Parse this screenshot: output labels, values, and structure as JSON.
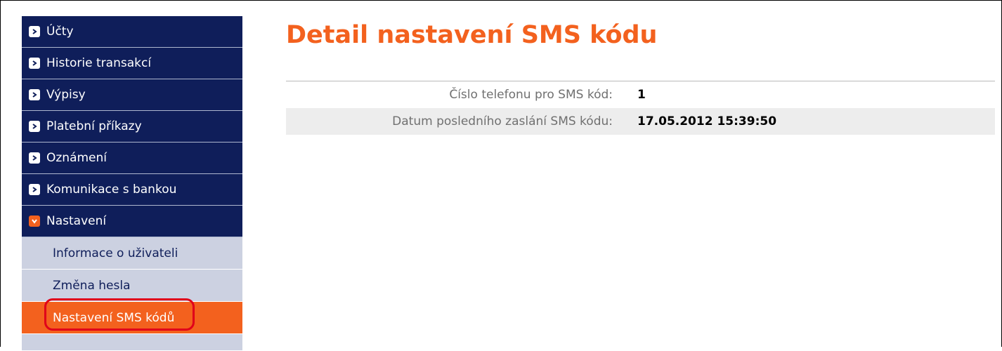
{
  "sidebar": {
    "items": [
      {
        "label": "Účty",
        "state": "collapsed"
      },
      {
        "label": "Historie transakcí",
        "state": "collapsed"
      },
      {
        "label": "Výpisy",
        "state": "collapsed"
      },
      {
        "label": "Platební příkazy",
        "state": "collapsed"
      },
      {
        "label": "Oznámení",
        "state": "collapsed"
      },
      {
        "label": "Komunikace s bankou",
        "state": "collapsed"
      },
      {
        "label": "Nastavení",
        "state": "expanded"
      }
    ],
    "sub_items": [
      {
        "label": "Informace o uživateli"
      },
      {
        "label": "Změna hesla"
      },
      {
        "label": "Nastavení SMS kódů",
        "active": true
      }
    ]
  },
  "main": {
    "title": "Detail nastavení SMS kódu",
    "rows": [
      {
        "label": "Číslo telefonu pro SMS kód:",
        "value": "1"
      },
      {
        "label": "Datum posledního zaslání SMS kódu:",
        "value": "17.05.2012 15:39:50"
      }
    ]
  },
  "colors": {
    "nav_background": "#0f1e5a",
    "submenu_background": "#ccd1e1",
    "accent_orange": "#f3611e",
    "highlight_red": "#e0001a"
  },
  "icons": {
    "collapsed": "chevron-right-icon",
    "expanded": "chevron-down-icon"
  }
}
